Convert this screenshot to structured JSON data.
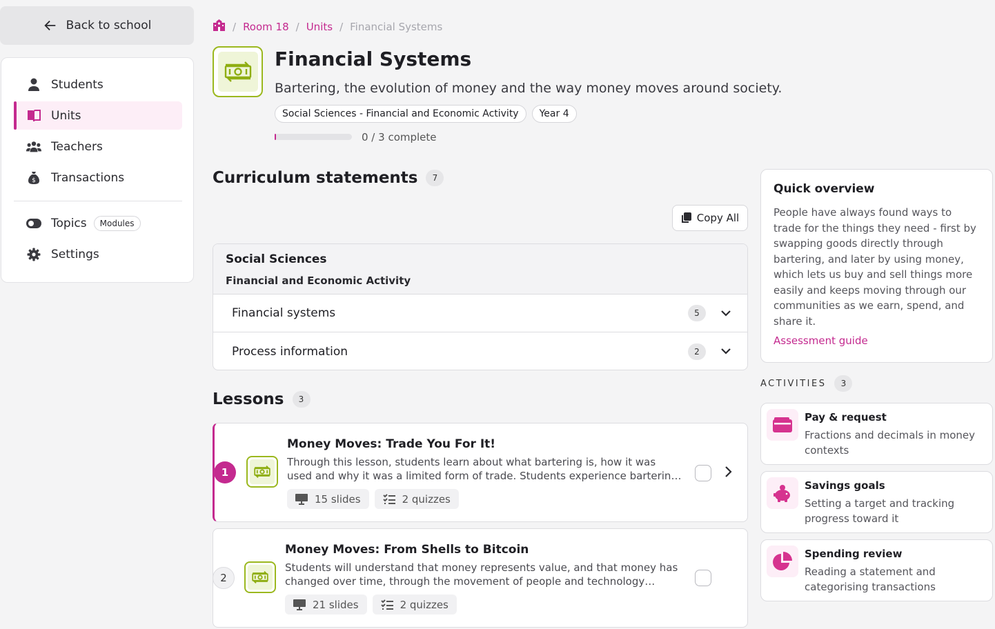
{
  "sidebar": {
    "back_label": "Back to school",
    "items": [
      {
        "label": "Students",
        "icon": "person-icon"
      },
      {
        "label": "Units",
        "icon": "book-icon",
        "active": true
      },
      {
        "label": "Teachers",
        "icon": "group-icon"
      },
      {
        "label": "Transactions",
        "icon": "money-bag-icon"
      }
    ],
    "topics_label": "Topics",
    "topics_badge": "Modules",
    "settings_label": "Settings"
  },
  "breadcrumb": [
    "Room 18",
    "Units",
    "Financial Systems"
  ],
  "unit": {
    "title": "Financial Systems",
    "subtitle": "Bartering, the evolution of money and the way money moves around society.",
    "tags": [
      "Social Sciences - Financial and Economic Activity",
      "Year 4"
    ],
    "progress_text": "0 / 3 complete",
    "progress_fraction": 0.02
  },
  "curriculum": {
    "heading": "Curriculum statements",
    "count": "7",
    "copy_label": "Copy All",
    "subject": "Social Sciences",
    "strand": "Financial and Economic Activity",
    "rows": [
      {
        "label": "Financial systems",
        "count": "5"
      },
      {
        "label": "Process information",
        "count": "2"
      }
    ]
  },
  "lessons": {
    "heading": "Lessons",
    "count": "3",
    "items": [
      {
        "num": "1",
        "title": "Money Moves: Trade You For It!",
        "desc": "Through this lesson, students learn about what bartering is, how it was used and why it was a limited form of trade. Students experience bartering for...",
        "slides": "15 slides",
        "quizzes": "2 quizzes"
      },
      {
        "num": "2",
        "title": "Money Moves: From Shells to Bitcoin",
        "desc": "Students will understand that money represents value, and that money has changed over time, through the movement of people and technology changes....",
        "slides": "21 slides",
        "quizzes": "2 quizzes"
      }
    ]
  },
  "overview": {
    "heading": "Quick overview",
    "body": "People have always found ways to trade for the things they need - first by swapping goods directly through bartering, and later by using money, which lets us buy and sell things more easily and keeps moving through our communities as we earn, spend, and share it.",
    "link": "Assessment guide"
  },
  "activities": {
    "heading": "ACTIVITIES",
    "count": "3",
    "items": [
      {
        "title": "Pay & request",
        "desc": "Fractions and decimals in money contexts",
        "icon": "wallet-icon"
      },
      {
        "title": "Savings goals",
        "desc": "Setting a target and tracking progress toward it",
        "icon": "piggy-bank-icon"
      },
      {
        "title": "Spending review",
        "desc": "Reading a statement and categorising transactions",
        "icon": "pie-chart-icon"
      }
    ]
  },
  "colors": {
    "accent": "#c42a8f",
    "unit_green": "#9bb81e"
  }
}
